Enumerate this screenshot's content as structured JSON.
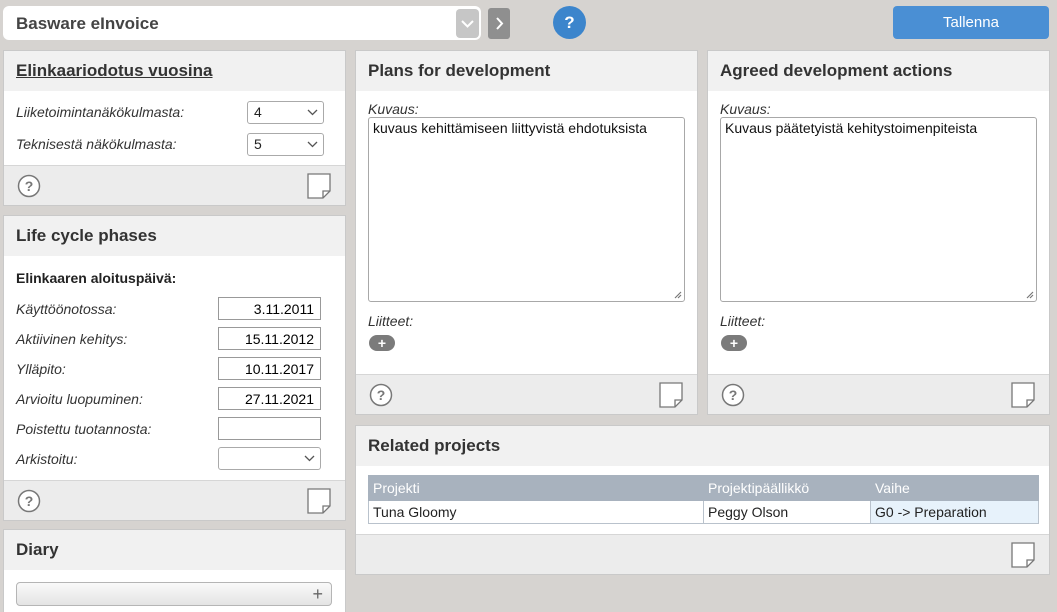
{
  "header": {
    "app_title": "Basware eInvoice",
    "help_label": "?",
    "save_label": "Tallenna"
  },
  "lifecycle_forecast": {
    "title": "Elinkaariodotus vuosina",
    "rows": [
      {
        "label": "Liiketoimintanäkökulmasta:",
        "value": "4"
      },
      {
        "label": "Teknisestä näkökulmasta:",
        "value": "5"
      }
    ]
  },
  "life_cycle_phases": {
    "title": "Life cycle phases",
    "subheading": "Elinkaaren aloituspäivä:",
    "rows": [
      {
        "label": "Käyttöönotossa:",
        "value": "3.11.2011"
      },
      {
        "label": "Aktiivinen kehitys:",
        "value": "15.11.2012"
      },
      {
        "label": "Ylläpito:",
        "value": "10.11.2017"
      },
      {
        "label": "Arvioitu luopuminen:",
        "value": "27.11.2021"
      },
      {
        "label": "Poistettu tuotannosta:",
        "value": ""
      },
      {
        "label": "Arkistoitu:",
        "value": ""
      }
    ]
  },
  "diary": {
    "title": "Diary",
    "add_symbol": "+"
  },
  "plans": {
    "title": "Plans for development",
    "description_label": "Kuvaus:",
    "description_value": "kuvaus kehittämiseen liittyvistä ehdotuksista",
    "attachments_label": "Liitteet:",
    "add_symbol": "+"
  },
  "agreed": {
    "title": "Agreed development actions",
    "description_label": "Kuvaus:",
    "description_value": "Kuvaus päätetyistä kehitystoimenpiteista",
    "attachments_label": "Liitteet:",
    "add_symbol": "+"
  },
  "related_projects": {
    "title": "Related projects",
    "columns": [
      "Projekti",
      "Projektipäällikkö",
      "Vaihe"
    ],
    "rows": [
      [
        "Tuna Gloomy",
        "Peggy Olson",
        "G0 -> Preparation"
      ]
    ]
  },
  "colors": {
    "accent_blue": "#4a8fd4",
    "help_blue": "#3c85cc",
    "table_header": "#a8b2be",
    "selected_cell": "#e7f2fb"
  },
  "icons": [
    "chevron-down-icon",
    "chevron-right-icon",
    "help-icon",
    "document-icon",
    "plus-icon",
    "resize-grip-icon"
  ]
}
